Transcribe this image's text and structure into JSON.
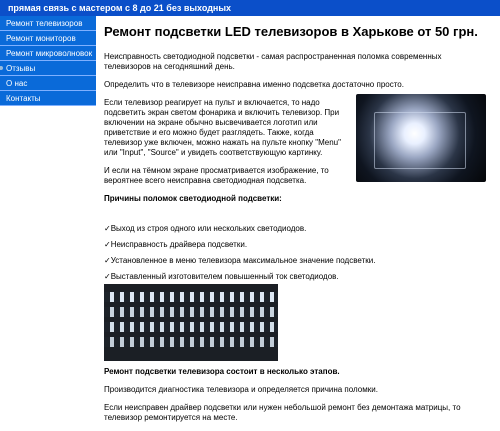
{
  "topbar": {
    "text": "прямая связь с мастером с 8 до 21 без выходных"
  },
  "sidebar": {
    "items": [
      {
        "label": "Ремонт телевизоров"
      },
      {
        "label": "Ремонт мониторов"
      },
      {
        "label": "Ремонт микроволновок"
      },
      {
        "label": "Отзывы"
      },
      {
        "label": "О нас"
      },
      {
        "label": "Контакты"
      }
    ]
  },
  "main": {
    "title": "Ремонт подсветки LED телевизоров в Харькове от 50 грн.",
    "intro1": "Неисправность светодиодной подсветки - самая распространенная поломка современных телевизоров на сегодняшний день.",
    "intro2": "Определить что в телевизоре неисправна именно подсветка достаточно просто.",
    "p3": "Если телевизор реагирует на пульт и включается, то надо подсветить экран светом фонарика и включить телевизор. При включении на экране обычно высвечивается логотип или приветствие и его можно будет разглядеть. Также, когда телевизор уже включен, можно нажать на пульте кнопку \"Menu\" или \"Input\", \"Source\" и увидеть соответствующую картинку.",
    "p4": "И если на тёмном экране просматривается изображение, то вероятнее всего неисправна светодиодная подсветка.",
    "causes_heading": "Причины поломок светодиодной подсветки:",
    "causes": [
      "✓Выход из строя одного или нескольких светодиодов.",
      "✓Неисправность драйвера подсветки.",
      "✓Установленное в меню телевизора максимальное значение подсветки.",
      "✓Выставленный изготовителем повышенный ток светодиодов."
    ],
    "repair_heading": "Ремонт подсветки телевизора состоит в несколько этапов.",
    "p5": "Производится диагностика телевизора и определяется причина поломки.",
    "p6": "Если неисправен драйвер подсветки или нужен небольшой ремонт без демонтажа матрицы, то телевизор ремонтируется на месте."
  }
}
